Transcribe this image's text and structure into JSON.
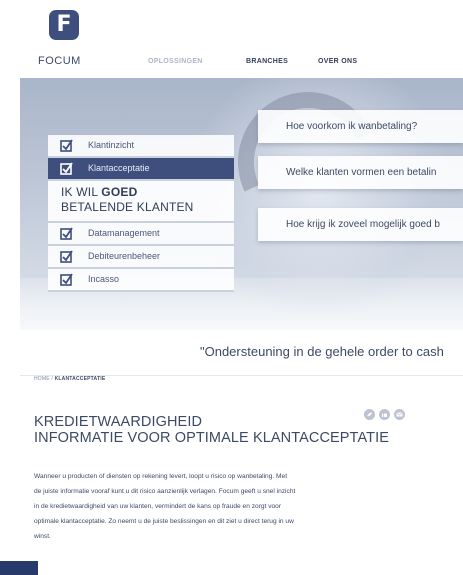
{
  "header": {
    "logo_letter": "F",
    "logo_text": "FOCUM",
    "nav": [
      "OPLOSSINGEN",
      "BRANCHES",
      "OVER ONS"
    ]
  },
  "menu": {
    "items_top": [
      {
        "label": "Klantinzicht",
        "active": false
      },
      {
        "label": "Klantacceptatie",
        "active": true
      }
    ],
    "headline_line1_pre": "IK WIL ",
    "headline_line1_bold": "GOED",
    "headline_line2": "BETALENDE KLANTEN",
    "items_bottom": [
      {
        "label": "Datamanagement"
      },
      {
        "label": "Debiteurenbeheer"
      },
      {
        "label": "Incasso"
      }
    ]
  },
  "questions": [
    "Hoe voorkom ik wanbetaling?",
    "Welke klanten vormen een betalin",
    "Hoe krijg ik zoveel mogelijk goed b"
  ],
  "tagline": "\"Ondersteuning in de gehele order to cash",
  "breadcrumb": {
    "home": "HOME / ",
    "current": "KLANTACCEPTATIE"
  },
  "article": {
    "title_line1": "KREDIETWAARDIGHEID",
    "title_line2": "INFORMATIE VOOR OPTIMALE KLANTACCEPTATIE",
    "body_lines": [
      "Wanneer u producten of diensten op rekening levert, loopt u risico op wanbetaling. Met",
      "de juiste informatie vooraf kunt u dit risico aanzienlijk verlagen. Focum geeft u snel inzicht",
      "in de kredietwaardigheid van uw klanten, vermindert de kans op fraude en zorgt voor",
      "optimale klantacceptatie. Zo neemt u de juiste beslissingen en dit ziet u direct terug in uw",
      "winst."
    ]
  },
  "colors": {
    "brand": "#3e4f7e",
    "text": "#3b4a66",
    "nav_muted": "#a9b6c8"
  }
}
